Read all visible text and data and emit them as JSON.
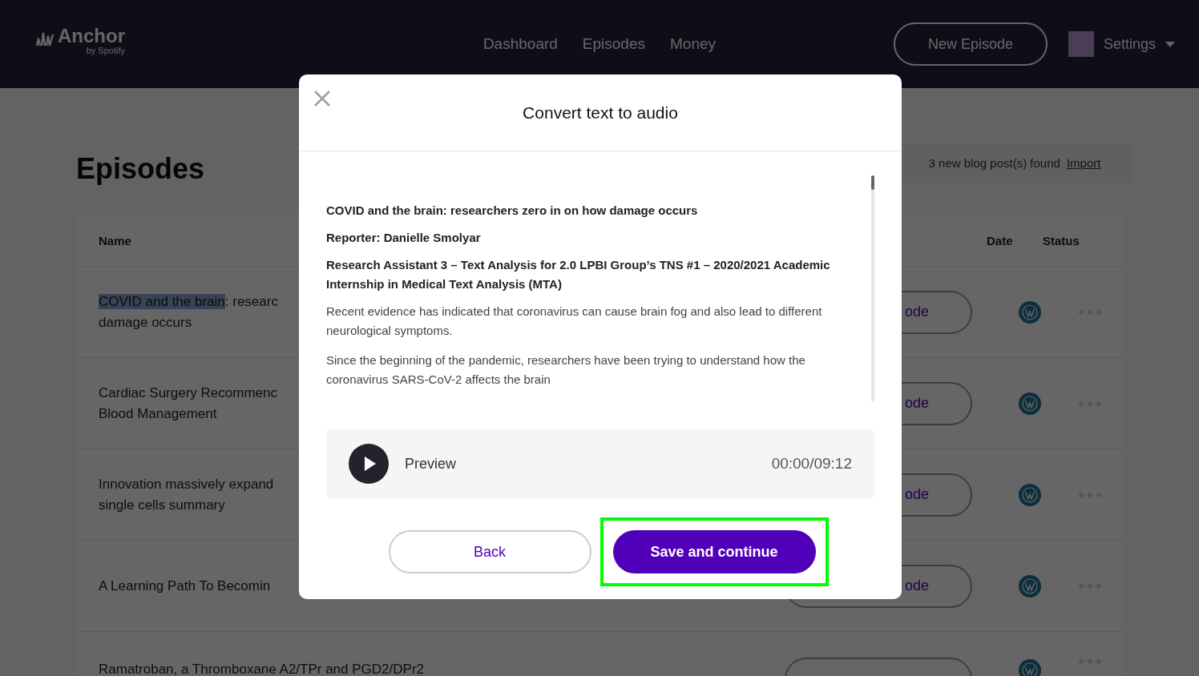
{
  "nav": {
    "logo": "Anchor",
    "logo_sub": "by Spotify",
    "links": [
      "Dashboard",
      "Episodes",
      "Money"
    ],
    "new_button": "New Episode",
    "settings": "Settings"
  },
  "page": {
    "title": "Episodes",
    "blog_notice": "3 new blog post(s) found",
    "import_link": "Import"
  },
  "table": {
    "columns": [
      "Name",
      "Date",
      "Status"
    ],
    "rows": [
      {
        "lines": [
          [
            {
              "text": "COVID and the brain",
              "selected": true
            },
            {
              "text": ": researc",
              "selected": false
            }
          ],
          [
            {
              "text": "damage occurs",
              "selected": false
            }
          ]
        ],
        "action": "ode",
        "kind": "wordpress"
      },
      {
        "lines": [
          [
            {
              "text": "Cardiac Surgery Recommenc",
              "selected": false
            }
          ],
          [
            {
              "text": "Blood Management",
              "selected": false
            }
          ]
        ],
        "action": "ode",
        "kind": "wordpress"
      },
      {
        "lines": [
          [
            {
              "text": "Innovation massively expand",
              "selected": false
            }
          ],
          [
            {
              "text": "single cells summary",
              "selected": false
            }
          ]
        ],
        "action": "ode",
        "kind": "wordpress"
      },
      {
        "lines": [
          [
            {
              "text": "A Learning Path To Becomin",
              "selected": false
            }
          ]
        ],
        "action": "ode",
        "kind": "wordpress"
      },
      {
        "lines": [
          [
            {
              "text": "Ramatroban, a Thromboxane A2/TPr and PGD2/DPr2",
              "selected": false
            }
          ]
        ],
        "kind": "wordpress"
      }
    ]
  },
  "modal": {
    "title": "Convert text to audio",
    "paragraphs": [
      {
        "text": "COVID and the brain: researchers zero in on how damage occurs",
        "bold": true
      },
      {
        "text": "Reporter: Danielle Smolyar",
        "bold": true
      },
      {
        "text": "Research Assistant 3 – Text Analysis for 2.0 LPBI Group’s TNS #1 – 2020/2021 Academic Internship in Medical Text Analysis (MTA)",
        "bold": true
      },
      {
        "text": "Recent evidence has indicated that coronavirus can cause brain fog and also lead to different neurological symptoms.",
        "bold": false
      },
      {
        "text": "Since the beginning of the pandemic, researchers have been trying to understand how the coronavirus SARS-CoV-2 affects the brain",
        "bold": false
      }
    ],
    "preview": {
      "label": "Preview",
      "time": "00:00/09:12"
    },
    "back": "Back",
    "save": {
      "label": "Save and continue",
      "highlighted": true
    }
  }
}
